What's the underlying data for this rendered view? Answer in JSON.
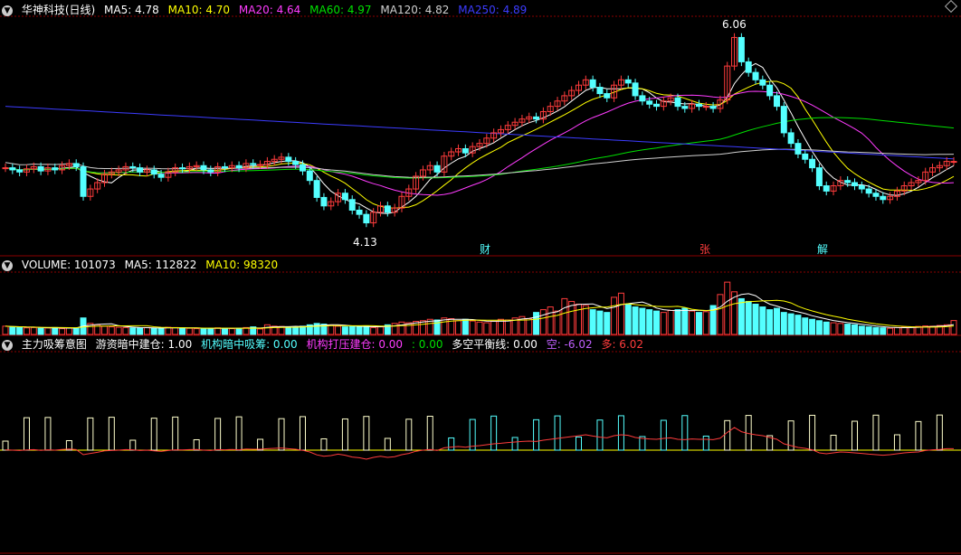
{
  "header": {
    "title": "华神科技(日线)",
    "ma5": "MA5: 4.78",
    "ma10": "MA10: 4.70",
    "ma20": "MA20: 4.64",
    "ma60": "MA60: 4.97",
    "ma120": "MA120: 4.82",
    "ma250": "MA250: 4.89"
  },
  "volume_bar": {
    "label": "VOLUME: 101073",
    "ma5": "MA5: 112822",
    "ma10": "MA10: 98320"
  },
  "indicator_bar": {
    "title": "主力吸筹意图",
    "i1": "游资暗中建仓: 1.00",
    "i2": "机构暗中吸筹: 0.00",
    "i3": "机构打压建仓: 0.00",
    "i4": ": 0.00",
    "i5": "多空平衡线: 0.00",
    "i6": "空: -6.02",
    "i7": "多: 6.02"
  },
  "annotations": {
    "high": "6.06",
    "low": "4.13",
    "tag1": "财",
    "tag2": "张",
    "tag3": "解"
  },
  "colors": {
    "up": "#ff3c3c",
    "down": "#54ffff",
    "ma5": "#ffffff",
    "ma10": "#ffff00",
    "ma20": "#ff3cff",
    "ma60": "#00e000",
    "ma120": "#d0d0d0",
    "ma250": "#3c3cff",
    "grid": "#8b0000"
  },
  "chart_data": {
    "type": "candlestick",
    "price_range": [
      4.0,
      6.15
    ],
    "closes": [
      4.72,
      4.7,
      4.68,
      4.71,
      4.73,
      4.69,
      4.72,
      4.7,
      4.74,
      4.76,
      4.73,
      4.45,
      4.52,
      4.58,
      4.66,
      4.68,
      4.7,
      4.73,
      4.72,
      4.68,
      4.7,
      4.66,
      4.63,
      4.68,
      4.72,
      4.71,
      4.73,
      4.74,
      4.7,
      4.68,
      4.73,
      4.72,
      4.74,
      4.72,
      4.76,
      4.75,
      4.75,
      4.78,
      4.8,
      4.82,
      4.78,
      4.75,
      4.69,
      4.6,
      4.44,
      4.36,
      4.4,
      4.48,
      4.42,
      4.32,
      4.28,
      4.2,
      4.3,
      4.36,
      4.3,
      4.34,
      4.45,
      4.52,
      4.64,
      4.7,
      4.74,
      4.68,
      4.83,
      4.87,
      4.9,
      4.86,
      4.92,
      4.95,
      5.0,
      5.05,
      5.08,
      5.12,
      5.15,
      5.18,
      5.2,
      5.18,
      5.25,
      5.3,
      5.35,
      5.4,
      5.45,
      5.5,
      5.55,
      5.48,
      5.42,
      5.38,
      5.5,
      5.55,
      5.52,
      5.4,
      5.35,
      5.32,
      5.3,
      5.35,
      5.38,
      5.3,
      5.28,
      5.32,
      5.3,
      5.3,
      5.28,
      5.36,
      5.68,
      5.95,
      5.72,
      5.62,
      5.55,
      5.5,
      5.4,
      5.3,
      5.05,
      4.95,
      4.85,
      4.8,
      4.72,
      4.55,
      4.5,
      4.55,
      4.6,
      4.58,
      4.55,
      4.52,
      4.48,
      4.45,
      4.42,
      4.45,
      4.5,
      4.55,
      4.58,
      4.6,
      4.68,
      4.72,
      4.74,
      4.78,
      4.78
    ],
    "volume_range": [
      0,
      440000
    ],
    "volumes": [
      60,
      55,
      52,
      48,
      50,
      45,
      47,
      50,
      42,
      46,
      48,
      120,
      80,
      70,
      60,
      55,
      52,
      50,
      48,
      46,
      50,
      45,
      44,
      52,
      50,
      48,
      45,
      42,
      40,
      44,
      48,
      46,
      42,
      45,
      50,
      55,
      40,
      70,
      60,
      58,
      55,
      52,
      60,
      70,
      80,
      75,
      65,
      60,
      55,
      58,
      56,
      60,
      50,
      55,
      70,
      80,
      90,
      85,
      95,
      100,
      110,
      105,
      120,
      115,
      100,
      110,
      98,
      90,
      85,
      95,
      110,
      105,
      120,
      130,
      115,
      160,
      180,
      200,
      170,
      260,
      240,
      220,
      210,
      180,
      170,
      160,
      270,
      300,
      220,
      200,
      190,
      180,
      170,
      160,
      175,
      180,
      190,
      170,
      160,
      165,
      210,
      290,
      380,
      310,
      260,
      240,
      220,
      200,
      180,
      190,
      160,
      150,
      140,
      120,
      110,
      100,
      90,
      85,
      80,
      75,
      70,
      60,
      55,
      50,
      48,
      45,
      50,
      52,
      55,
      58,
      62,
      60,
      65,
      70,
      101
    ]
  }
}
